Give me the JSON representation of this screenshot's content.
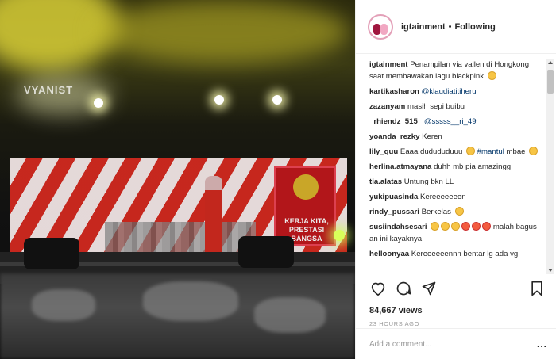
{
  "post": {
    "username": "igtainment",
    "separator": "•",
    "follow_status": "Following",
    "views": "84,667 views",
    "time": "23 HOURS AGO"
  },
  "caption": {
    "user": "igtainment",
    "text": "Penampilan via vallen di Hongkong saat membawakan lagu blackpink"
  },
  "comments": [
    {
      "user": "kartikasharon",
      "text": "",
      "mention": "@klaudiatitiheru"
    },
    {
      "user": "zazanyam",
      "text": "masih sepi buibu",
      "mention": ""
    },
    {
      "user": "_rhiendz_515_",
      "text": "",
      "mention": "@sssss__ri_49"
    },
    {
      "user": "yoanda_rezky",
      "text": "Keren",
      "mention": ""
    },
    {
      "user": "lily_quu",
      "text": "Eaaa dudududuuu",
      "mention": "#mantul",
      "after": "mbae"
    },
    {
      "user": "herlina.atmayana",
      "text": "duhh mb pia amazingg",
      "mention": ""
    },
    {
      "user": "tia.alatas",
      "text": "Untung bkn LL",
      "mention": ""
    },
    {
      "user": "yukipuasinda",
      "text": "Kereeeeeeen",
      "mention": ""
    },
    {
      "user": "rindy_pussari",
      "text": "Berkelas",
      "mention": ""
    },
    {
      "user": "susiindahsesari",
      "text": "malah bagus an ini kayaknya",
      "mention": ""
    },
    {
      "user": "helloonyaa",
      "text": "Kereeeeeennn bentar lg ada vg",
      "mention": ""
    }
  ],
  "video": {
    "banner_text": "KERJA KITA, PRESTASI BANGSA",
    "sign_text": "VYANIST"
  },
  "compose": {
    "placeholder": "Add a comment...",
    "more_label": "..."
  },
  "icons": {
    "like": "heart-icon",
    "comment": "comment-icon",
    "share": "share-icon",
    "save": "bookmark-icon"
  },
  "colors": {
    "mention": "#003569",
    "text": "#262626",
    "muted": "#999999"
  }
}
